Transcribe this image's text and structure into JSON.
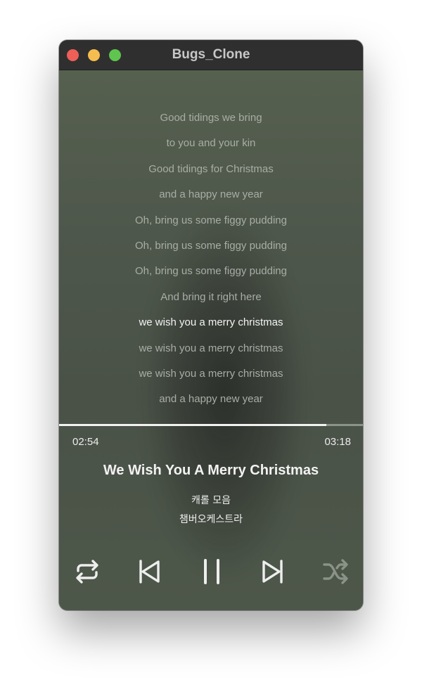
{
  "window": {
    "title": "Bugs_Clone"
  },
  "lyrics": {
    "lines": [
      "Good tidings we bring",
      "to you and your kin",
      "Good tidings for Christmas",
      "and a happy new year",
      "Oh, bring us some figgy pudding",
      "Oh, bring us some figgy pudding",
      "Oh, bring us some figgy pudding",
      "And bring it right here",
      "we wish you a merry christmas",
      "we wish you a merry christmas",
      "we wish you a merry christmas",
      "and a happy new year"
    ],
    "current_index": 8
  },
  "player": {
    "elapsed": "02:54",
    "total": "03:18",
    "progress_fraction": 0.879,
    "song_title": "We Wish You A Merry Christmas",
    "album": "캐롤 모음",
    "artist": "챔버오케스트라"
  },
  "controls": {
    "repeat_icon": "repeat-icon",
    "previous_icon": "skip-back-icon",
    "play_pause_icon": "pause-icon",
    "next_icon": "skip-forward-icon",
    "shuffle_icon": "shuffle-icon",
    "shuffle_active": false
  },
  "colors": {
    "background": "#4b5449",
    "titlebar": "#302f30",
    "lyric_inactive": "#a8ada5",
    "lyric_active": "#f4f4f4",
    "progress_fill": "#f2f2f2",
    "progress_track": "#8d928b"
  }
}
